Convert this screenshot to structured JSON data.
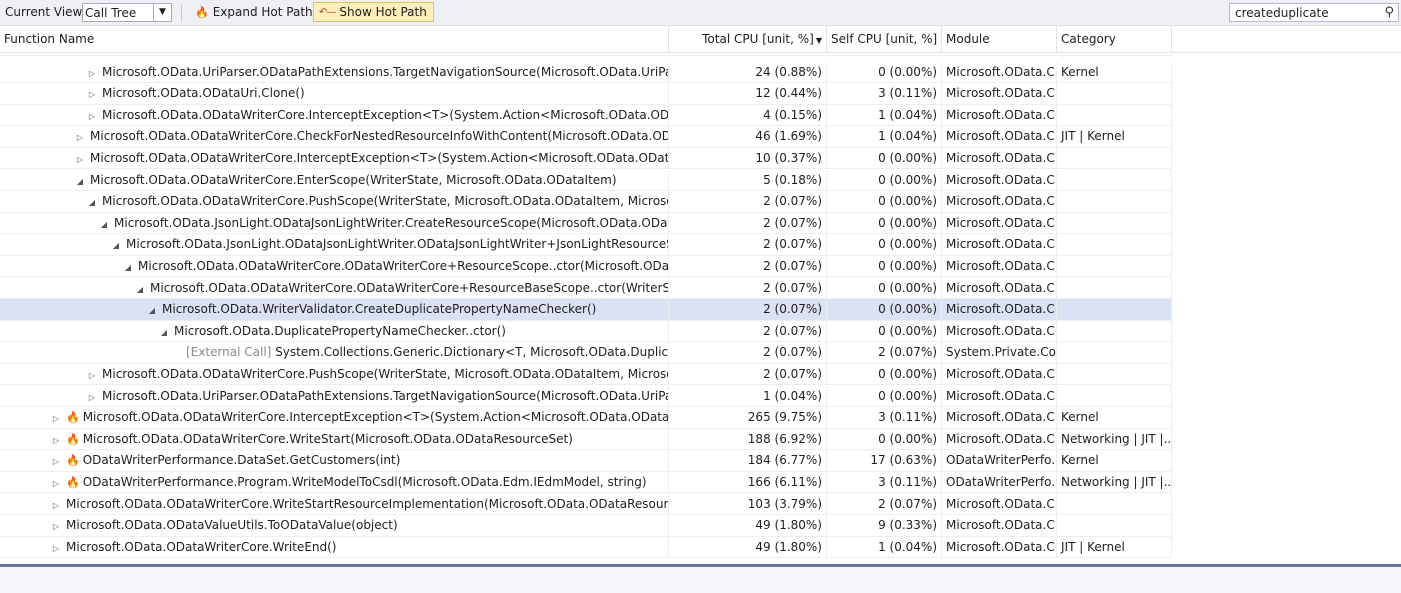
{
  "toolbar": {
    "current_view_label": "Current View:",
    "current_view_value": "Call Tree",
    "expand_hot_path_label": "Expand Hot Path",
    "show_hot_path_label": "Show Hot Path",
    "search_value": "createduplicate"
  },
  "columns": {
    "function_name": "Function Name",
    "total_cpu": "Total CPU [unit, %]",
    "self_cpu": "Self CPU [unit, %]",
    "module": "Module",
    "category": "Category"
  },
  "rows": [
    {
      "indent": 7,
      "expander": "right",
      "hot": false,
      "external": "",
      "name": "Microsoft.OData.UriParser.ODataPathExtensions.TargetNavigationSource(Microsoft.OData.UriParser.ODa...",
      "total": "24 (0.88%)",
      "self": "0 (0.00%)",
      "module": "Microsoft.OData.C...",
      "category": "Kernel"
    },
    {
      "indent": 7,
      "expander": "right",
      "hot": false,
      "external": "",
      "name": "Microsoft.OData.ODataUri.Clone()",
      "total": "12 (0.44%)",
      "self": "3 (0.11%)",
      "module": "Microsoft.OData.C...",
      "category": ""
    },
    {
      "indent": 7,
      "expander": "right",
      "hot": false,
      "external": "",
      "name": "Microsoft.OData.ODataWriterCore.InterceptException<T>(System.Action<Microsoft.OData.ODataWriter...",
      "total": "4 (0.15%)",
      "self": "1 (0.04%)",
      "module": "Microsoft.OData.C...",
      "category": ""
    },
    {
      "indent": 6,
      "expander": "right",
      "hot": false,
      "external": "",
      "name": "Microsoft.OData.ODataWriterCore.CheckForNestedResourceInfoWithContent(Microsoft.OData.ODataPaylo...",
      "total": "46 (1.69%)",
      "self": "1 (0.04%)",
      "module": "Microsoft.OData.C...",
      "category": "JIT | Kernel"
    },
    {
      "indent": 6,
      "expander": "right",
      "hot": false,
      "external": "",
      "name": "Microsoft.OData.ODataWriterCore.InterceptException<T>(System.Action<Microsoft.OData.ODataWriterCo...",
      "total": "10 (0.37%)",
      "self": "0 (0.00%)",
      "module": "Microsoft.OData.C...",
      "category": ""
    },
    {
      "indent": 6,
      "expander": "down",
      "hot": false,
      "external": "",
      "name": "Microsoft.OData.ODataWriterCore.EnterScope(WriterState, Microsoft.OData.ODataItem)",
      "total": "5 (0.18%)",
      "self": "0 (0.00%)",
      "module": "Microsoft.OData.C...",
      "category": ""
    },
    {
      "indent": 7,
      "expander": "down",
      "hot": false,
      "external": "",
      "name": "Microsoft.OData.ODataWriterCore.PushScope(WriterState, Microsoft.OData.ODataItem, Microsoft.OData...",
      "total": "2 (0.07%)",
      "self": "0 (0.00%)",
      "module": "Microsoft.OData.C...",
      "category": ""
    },
    {
      "indent": 8,
      "expander": "down",
      "hot": false,
      "external": "",
      "name": "Microsoft.OData.JsonLight.ODataJsonLightWriter.CreateResourceScope(Microsoft.OData.ODataResour...",
      "total": "2 (0.07%)",
      "self": "0 (0.00%)",
      "module": "Microsoft.OData.C...",
      "category": ""
    },
    {
      "indent": 9,
      "expander": "down",
      "hot": false,
      "external": "",
      "name": "Microsoft.OData.JsonLight.ODataJsonLightWriter.ODataJsonLightWriter+JsonLightResourceScope..c...",
      "total": "2 (0.07%)",
      "self": "0 (0.00%)",
      "module": "Microsoft.OData.C...",
      "category": ""
    },
    {
      "indent": 10,
      "expander": "down",
      "hot": false,
      "external": "",
      "name": "Microsoft.OData.ODataWriterCore.ODataWriterCore+ResourceScope..ctor(Microsoft.OData.OData...",
      "total": "2 (0.07%)",
      "self": "0 (0.00%)",
      "module": "Microsoft.OData.C...",
      "category": ""
    },
    {
      "indent": 11,
      "expander": "down",
      "hot": false,
      "external": "",
      "name": "Microsoft.OData.ODataWriterCore.ODataWriterCore+ResourceBaseScope..ctor(WriterState, Mic...",
      "total": "2 (0.07%)",
      "self": "0 (0.00%)",
      "module": "Microsoft.OData.C...",
      "category": ""
    },
    {
      "indent": 12,
      "expander": "down",
      "hot": false,
      "external": "",
      "name": "Microsoft.OData.WriterValidator.CreateDuplicatePropertyNameChecker()",
      "total": "2 (0.07%)",
      "self": "0 (0.00%)",
      "module": "Microsoft.OData.C...",
      "category": "",
      "selected": true
    },
    {
      "indent": 13,
      "expander": "down",
      "hot": false,
      "external": "",
      "name": "Microsoft.OData.DuplicatePropertyNameChecker..ctor()",
      "total": "2 (0.07%)",
      "self": "0 (0.00%)",
      "module": "Microsoft.OData.C...",
      "category": ""
    },
    {
      "indent": 14,
      "expander": "none",
      "hot": false,
      "external": "[External Call]",
      "name": " System.Collections.Generic.Dictionary<T, Microsoft.OData.DuplicateProper...",
      "total": "2 (0.07%)",
      "self": "2 (0.07%)",
      "module": "System.Private.Co...",
      "category": ""
    },
    {
      "indent": 7,
      "expander": "right",
      "hot": false,
      "external": "",
      "name": "Microsoft.OData.ODataWriterCore.PushScope(WriterState, Microsoft.OData.ODataItem, Microsoft.OData...",
      "total": "2 (0.07%)",
      "self": "0 (0.00%)",
      "module": "Microsoft.OData.C...",
      "category": ""
    },
    {
      "indent": 7,
      "expander": "right",
      "hot": false,
      "external": "",
      "name": "Microsoft.OData.UriParser.ODataPathExtensions.TargetNavigationSource(Microsoft.OData.UriParser.ODa...",
      "total": "1 (0.04%)",
      "self": "0 (0.00%)",
      "module": "Microsoft.OData.C...",
      "category": ""
    },
    {
      "indent": 4,
      "expander": "right",
      "hot": true,
      "external": "",
      "name": "Microsoft.OData.ODataWriterCore.InterceptException<T>(System.Action<Microsoft.OData.ODataWriterCore...",
      "total": "265 (9.75%)",
      "self": "3 (0.11%)",
      "module": "Microsoft.OData.C...",
      "category": "Kernel"
    },
    {
      "indent": 4,
      "expander": "right",
      "hot": true,
      "external": "",
      "name": "Microsoft.OData.ODataWriterCore.WriteStart(Microsoft.OData.ODataResourceSet)",
      "total": "188 (6.92%)",
      "self": "0 (0.00%)",
      "module": "Microsoft.OData.C...",
      "category": "Networking | JIT |..."
    },
    {
      "indent": 4,
      "expander": "right",
      "hot": true,
      "external": "",
      "name": "ODataWriterPerformance.DataSet.GetCustomers(int)",
      "total": "184 (6.77%)",
      "self": "17 (0.63%)",
      "module": "ODataWriterPerfo...",
      "category": "Kernel"
    },
    {
      "indent": 4,
      "expander": "right",
      "hot": true,
      "external": "",
      "name": "ODataWriterPerformance.Program.WriteModelToCsdl(Microsoft.OData.Edm.IEdmModel, string)",
      "total": "166 (6.11%)",
      "self": "3 (0.11%)",
      "module": "ODataWriterPerfo...",
      "category": "Networking | JIT |..."
    },
    {
      "indent": 4,
      "expander": "right",
      "hot": false,
      "external": "",
      "name": "Microsoft.OData.ODataWriterCore.WriteStartResourceImplementation(Microsoft.OData.ODataResource)",
      "total": "103 (3.79%)",
      "self": "2 (0.07%)",
      "module": "Microsoft.OData.C...",
      "category": ""
    },
    {
      "indent": 4,
      "expander": "right",
      "hot": false,
      "external": "",
      "name": "Microsoft.OData.ODataValueUtils.ToODataValue(object)",
      "total": "49 (1.80%)",
      "self": "9 (0.33%)",
      "module": "Microsoft.OData.C...",
      "category": ""
    },
    {
      "indent": 4,
      "expander": "right",
      "hot": false,
      "external": "",
      "name": "Microsoft.OData.ODataWriterCore.WriteEnd()",
      "total": "49 (1.80%)",
      "self": "1 (0.04%)",
      "module": "Microsoft.OData.C...",
      "category": "JIT | Kernel"
    }
  ]
}
